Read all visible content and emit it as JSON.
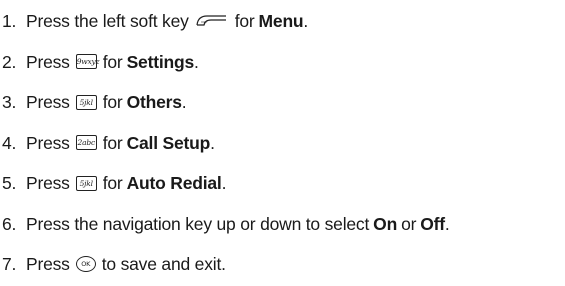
{
  "steps": [
    {
      "num": "1.",
      "pre": "Press the left soft key",
      "key_icon": "left-soft-key-icon",
      "post": "for",
      "bold": "Menu",
      "tail": "."
    },
    {
      "num": "2.",
      "pre": "Press",
      "key_label": "9wxyz",
      "key_icon": "nine-key-icon",
      "post": "for",
      "bold": "Settings",
      "tail": "."
    },
    {
      "num": "3.",
      "pre": "Press",
      "key_label": "5jkl",
      "key_icon": "five-key-icon",
      "post": "for",
      "bold": "Others",
      "tail": "."
    },
    {
      "num": "4.",
      "pre": "Press",
      "key_label": "2abc",
      "key_icon": "two-key-icon",
      "post": "for",
      "bold": "Call Setup",
      "tail": "."
    },
    {
      "num": "5.",
      "pre": "Press",
      "key_label": "5jkl",
      "key_icon": "five-key-icon",
      "post": "for",
      "bold": "Auto Redial",
      "tail": "."
    },
    {
      "num": "6.",
      "pre": "Press the navigation key up or down to select",
      "bold": "On",
      "mid": "or",
      "bold2": "Off",
      "tail": "."
    },
    {
      "num": "7.",
      "pre": "Press",
      "key_label": "OK",
      "key_icon": "ok-key-icon",
      "post": "to save and exit."
    }
  ]
}
